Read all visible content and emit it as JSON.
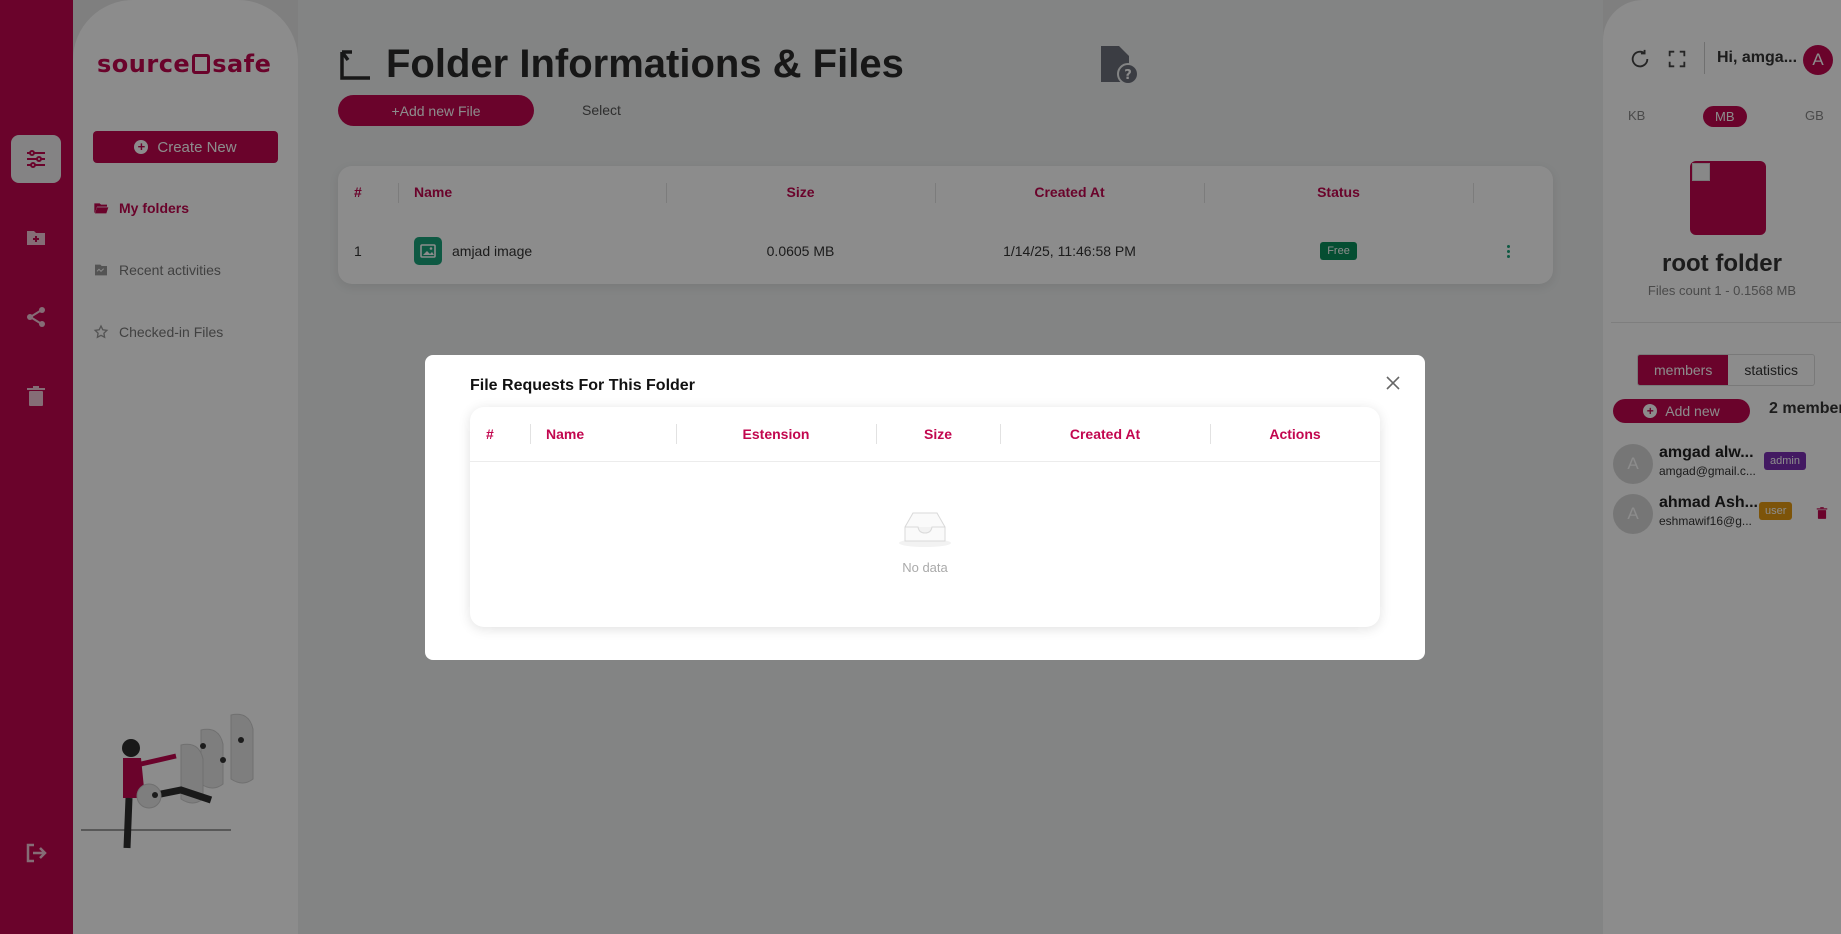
{
  "app": {
    "brand": "source",
    "brand_suffix": "safe"
  },
  "sidebar": {
    "create_label": "Create New",
    "items": [
      {
        "label": "My folders",
        "icon": "folder-open-icon",
        "active": true
      },
      {
        "label": "Recent activities",
        "icon": "activity-icon",
        "active": false
      },
      {
        "label": "Checked-in Files",
        "icon": "star-icon",
        "active": false
      }
    ]
  },
  "rail": {
    "icons": [
      "sliders-icon",
      "folder-plus-icon",
      "share-icon",
      "trash-icon",
      "logout-icon"
    ]
  },
  "main": {
    "title": "Folder Informations & Files",
    "add_file_label": "+Add new File",
    "select_label": "Select",
    "table": {
      "headers": [
        "#",
        "Name",
        "Size",
        "Created At",
        "Status"
      ],
      "rows": [
        {
          "index": "1",
          "name": "amjad image",
          "size": "0.0605 MB",
          "created_at": "1/14/25, 11:46:58 PM",
          "status": "Free"
        }
      ]
    }
  },
  "right_panel": {
    "greeting": "Hi, amga...",
    "avatar_letter": "A",
    "units": [
      "KB",
      "MB",
      "GB"
    ],
    "selected_unit": "MB",
    "folder_title": "root folder",
    "files_count": "Files count 1 - 0.1568 MB",
    "tabs": [
      "members",
      "statistics"
    ],
    "active_tab": "members",
    "add_new_label": "Add new",
    "members_count": "2 member",
    "members": [
      {
        "avatar": "A",
        "name": "amgad alw...",
        "email": "amgad@gmail.c...",
        "role": "admin",
        "role_color": "#7b2fb3"
      },
      {
        "avatar": "A",
        "name": "ahmad Ash...",
        "email": "eshmawif16@g...",
        "role": "user",
        "role_color": "#e39a12"
      }
    ]
  },
  "modal": {
    "title": "File Requests For This Folder",
    "headers": [
      "#",
      "Name",
      "Estension",
      "Size",
      "Created At",
      "Actions"
    ],
    "empty_text": "No data"
  },
  "colors": {
    "accent": "#c2074f",
    "success": "#0a8f5c",
    "file_icon": "#1aa37a"
  }
}
